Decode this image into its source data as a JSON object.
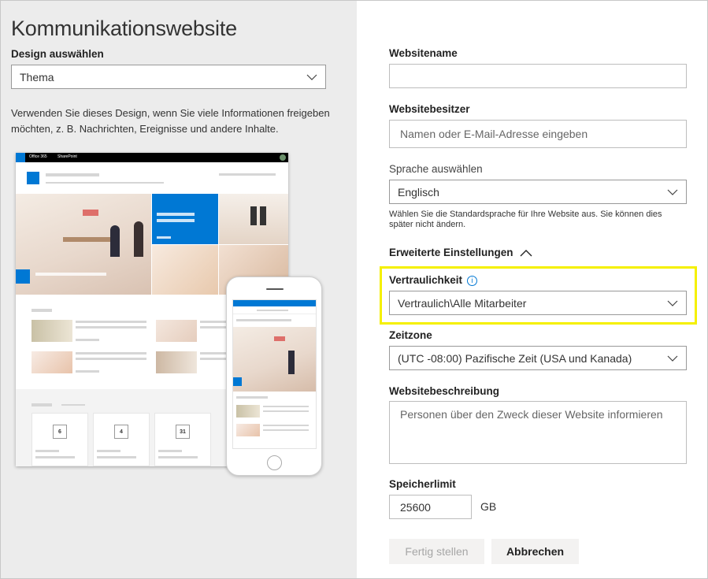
{
  "left_panel": {
    "title": "Kommunikationswebsite",
    "design_label": "Design auswählen",
    "design_value": "Thema",
    "description": "Verwenden Sie dieses Design, wenn Sie viele Informationen freigeben möchten, z. B. Nachrichten, Ereignisse und andere Inhalte.",
    "preview": {
      "suitebar_app": "Office 365",
      "suitebar_site": "SharePoint",
      "event_dates": [
        "6",
        "4",
        "31"
      ]
    }
  },
  "form": {
    "site_name_label": "Websitename",
    "site_name_value": "",
    "owner_label": "Websitebesitzer",
    "owner_placeholder": "Namen oder E-Mail-Adresse eingeben",
    "language_label": "Sprache auswählen",
    "language_value": "Englisch",
    "language_help": "Wählen Sie die Standardsprache für Ihre Website aus. Sie können dies später nicht ändern.",
    "advanced_label": "Erweiterte Einstellungen",
    "privacy_label": "Vertraulichkeit",
    "privacy_value": "Vertraulich\\Alle Mitarbeiter",
    "timezone_label": "Zeitzone",
    "timezone_value": "(UTC -08:00) Pazifische Zeit (USA und Kanada)",
    "description_label": "Websitebeschreibung",
    "description_placeholder": "Personen über den Zweck dieser Website informieren",
    "storage_label": "Speicherlimit",
    "storage_value": "25600",
    "storage_unit": "GB",
    "finish_button": "Fertig stellen",
    "cancel_button": "Abbrechen"
  },
  "colors": {
    "accent": "#0078d4",
    "highlight": "#f5f000",
    "left_bg": "#ececec"
  }
}
